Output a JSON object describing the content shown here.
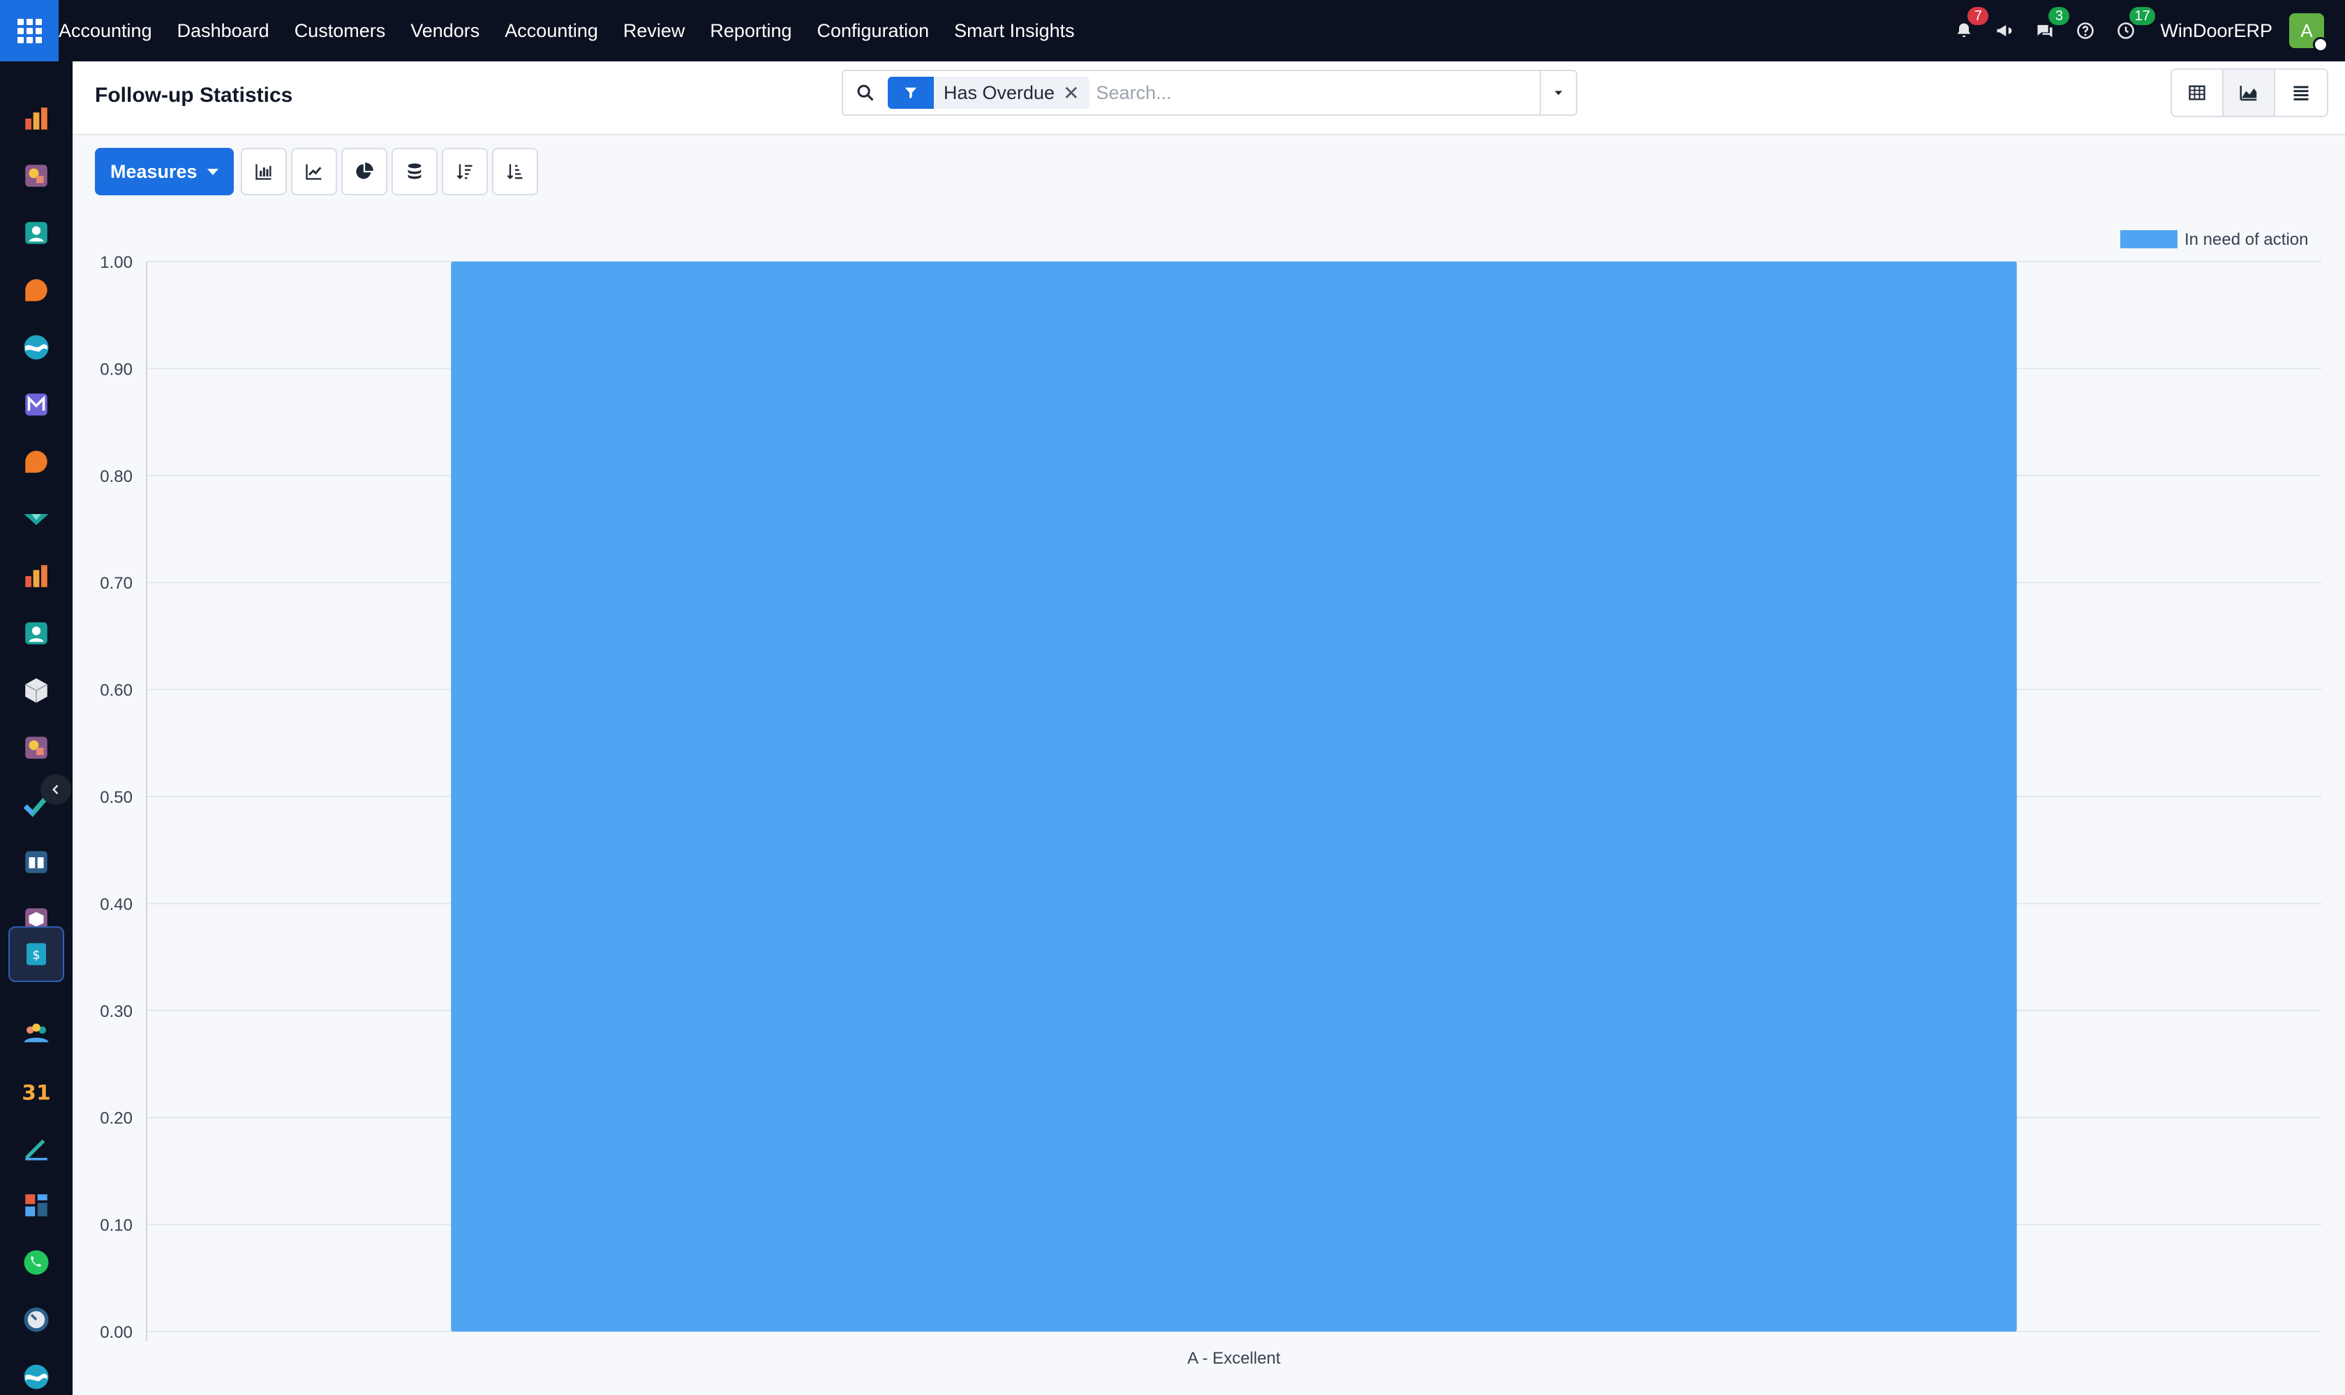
{
  "navbar": {
    "menu": [
      "Accounting",
      "Dashboard",
      "Customers",
      "Vendors",
      "Accounting",
      "Review",
      "Reporting",
      "Configuration",
      "Smart Insights"
    ],
    "badges": {
      "notifications": "7",
      "messages": "3",
      "activities": "17"
    },
    "badge_colors": {
      "notifications": "#d93644",
      "messages": "#16a34a",
      "activities": "#16a34a"
    },
    "company": "WinDoorERP",
    "avatar_initial": "A",
    "icons": [
      "bell-icon",
      "megaphone-icon",
      "chat-icon",
      "help-icon",
      "clock-icon"
    ]
  },
  "sidebar": {
    "apps": [
      "sales-app-icon",
      "marketing-app-icon",
      "contacts-app-icon",
      "discuss-app-icon",
      "sync-app-icon",
      "mail-app-icon",
      "chat-app-icon",
      "inventory-app-icon",
      "reporting-app-icon",
      "employees-app-icon",
      "product-app-icon",
      "knowledge-app-icon",
      "tasks-app-icon",
      "library-app-icon",
      "packages-app-icon",
      "invoicing-app-icon",
      "team-app-icon",
      "calendar-app-icon",
      "sign-app-icon",
      "dashboards-app-icon",
      "whatsapp-app-icon",
      "timer-app-icon",
      "flow-app-icon"
    ],
    "active_index": 15,
    "calendar_text": "31"
  },
  "control_panel": {
    "title": "Follow-up Statistics",
    "facet_label": "Has Overdue",
    "search_placeholder": "Search...",
    "views": [
      "pivot-view-icon",
      "graph-view-icon",
      "list-view-icon"
    ],
    "active_view": 1
  },
  "toolbar": {
    "measures_label": "Measures",
    "tools": [
      "bar-chart-icon",
      "line-chart-icon",
      "pie-chart-icon",
      "stacked-icon",
      "sort-descending-icon",
      "sort-ascending-icon"
    ]
  },
  "colors": {
    "accent": "#1b6fe0",
    "navbar": "#0b1120",
    "bar": "#4ea6f2"
  },
  "chart_data": {
    "type": "bar",
    "categories": [
      "A - Excellent"
    ],
    "series": [
      {
        "name": "In need of action",
        "values": [
          1.0
        ]
      }
    ],
    "ylim": [
      0,
      1
    ],
    "yticks": [
      "0.00",
      "0.10",
      "0.20",
      "0.30",
      "0.40",
      "0.50",
      "0.60",
      "0.70",
      "0.80",
      "0.90",
      "1.00"
    ],
    "grid": true,
    "legend": "top-right"
  }
}
